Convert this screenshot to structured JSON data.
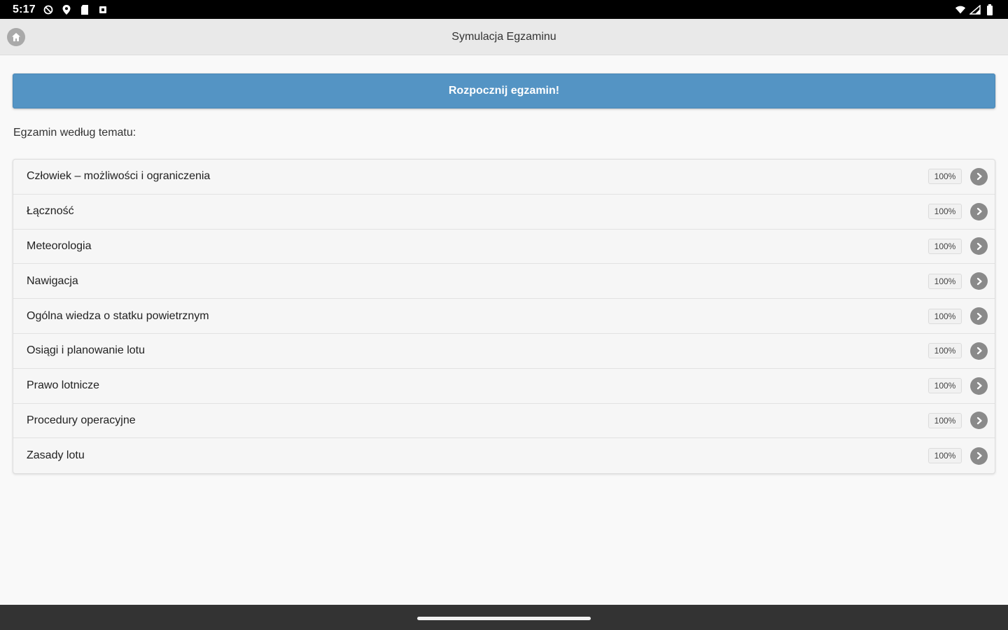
{
  "status_bar": {
    "time": "5:17",
    "left_icons": [
      "do-not-disturb-icon",
      "location-pin-icon",
      "sd-card-icon",
      "square-notification-icon"
    ],
    "right_icons": [
      "wifi-icon",
      "cellular-signal-icon",
      "battery-icon"
    ]
  },
  "header": {
    "title": "Symulacja Egzaminu",
    "home_icon": "home-icon"
  },
  "start_button": {
    "label": "Rozpocznij egzamin!",
    "color": "#5494c4"
  },
  "section_label": "Egzamin według tematu:",
  "topics": [
    {
      "label": "Człowiek – możliwości i ograniczenia",
      "percent": "100%"
    },
    {
      "label": "Łączność",
      "percent": "100%"
    },
    {
      "label": "Meteorologia",
      "percent": "100%"
    },
    {
      "label": "Nawigacja",
      "percent": "100%"
    },
    {
      "label": "Ogólna wiedza o statku powietrznym",
      "percent": "100%"
    },
    {
      "label": "Osiągi i planowanie lotu",
      "percent": "100%"
    },
    {
      "label": "Prawo lotnicze",
      "percent": "100%"
    },
    {
      "label": "Procedury operacyjne",
      "percent": "100%"
    },
    {
      "label": "Zasady lotu",
      "percent": "100%"
    }
  ],
  "row_icon": "chevron-right-circle-icon"
}
